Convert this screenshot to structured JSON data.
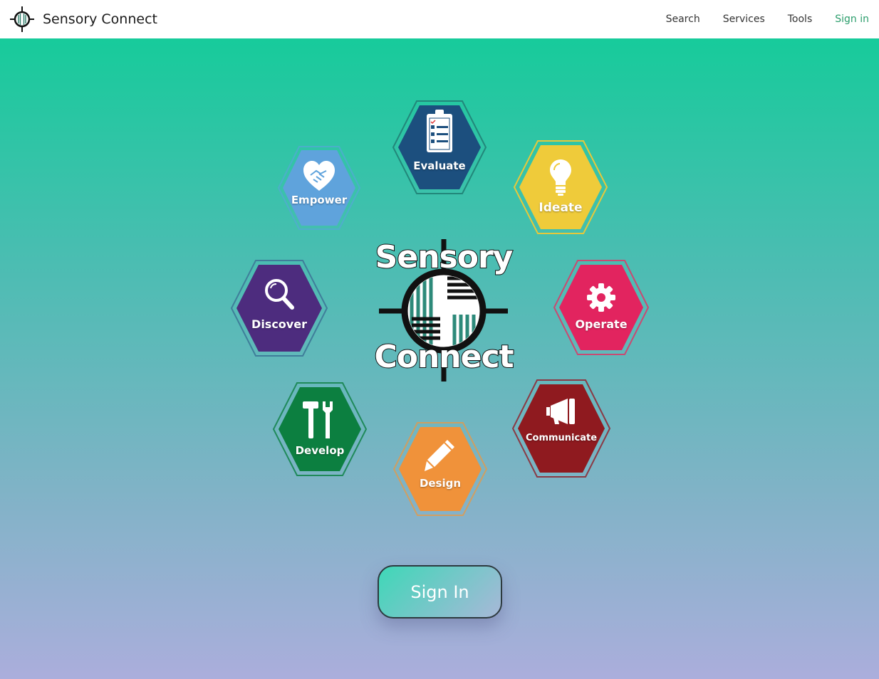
{
  "header": {
    "brand_name": "Sensory Connect",
    "brand_icon": "crosshair-logo-icon",
    "nav": {
      "search": "Search",
      "services": "Services",
      "tools": "Tools",
      "signin": "Sign in"
    }
  },
  "hexagons": {
    "evaluate": {
      "label": "Evaluate",
      "color": "#1c4f7e",
      "icon": "clipboard-checklist-icon"
    },
    "empower": {
      "label": "Empower",
      "color": "#5fa3dc",
      "icon": "heart-handshake-icon"
    },
    "ideate": {
      "label": "Ideate",
      "color": "#efcb3a",
      "icon": "lightbulb-icon"
    },
    "discover": {
      "label": "Discover",
      "color": "#4d2c7e",
      "icon": "magnifier-icon"
    },
    "operate": {
      "label": "Operate",
      "color": "#e2245f",
      "icon": "gear-icon"
    },
    "develop": {
      "label": "Develop",
      "color": "#0c7f40",
      "icon": "hammer-wrench-icon"
    },
    "communicate": {
      "label": "Communicate",
      "color": "#8f1a1f",
      "icon": "megaphone-icon"
    },
    "design": {
      "label": "Design",
      "color": "#f0923a",
      "icon": "pencil-icon"
    }
  },
  "center_logo": {
    "word_top": "Sensory",
    "word_bottom": "Connect",
    "icon": "crosshair-logo-icon"
  },
  "signin_button": {
    "label": "Sign In"
  }
}
